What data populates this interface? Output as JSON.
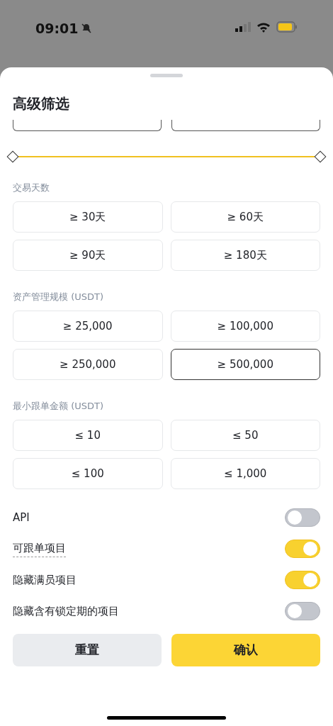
{
  "status_bar": {
    "time": "09:01",
    "silent": true
  },
  "sheet": {
    "title": "高级筛选",
    "range_fields": [
      {
        "kind": "field"
      },
      {
        "kind": "field"
      }
    ],
    "range_slider": {
      "thumbs": [
        {
          "level": 0
        },
        {
          "level": 1
        }
      ]
    },
    "sections": [
      {
        "label": "交易天数",
        "options": [
          {
            "label": "≥ 30天",
            "selected": false
          },
          {
            "label": "≥ 60天",
            "selected": false
          },
          {
            "label": "≥ 90天",
            "selected": false
          },
          {
            "label": "≥ 180天",
            "selected": false
          }
        ]
      },
      {
        "label": "资产管理规模 (USDT)",
        "options": [
          {
            "label": "≥ 25,000",
            "selected": false
          },
          {
            "label": "≥ 100,000",
            "selected": false
          },
          {
            "label": "≥ 250,000",
            "selected": false
          },
          {
            "label": "≥ 500,000",
            "selected": true
          }
        ]
      },
      {
        "label": "最小跟单金额 (USDT)",
        "options": [
          {
            "label": "≤ 10",
            "selected": false
          },
          {
            "label": "≤ 50",
            "selected": false
          },
          {
            "label": "≤ 100",
            "selected": false
          },
          {
            "label": "≤ 1,000",
            "selected": false
          }
        ]
      }
    ],
    "toggles": [
      {
        "label": "API",
        "on": false,
        "underlined": false
      },
      {
        "label": "可跟单项目",
        "on": true,
        "underlined": true
      },
      {
        "label": "隐藏满员项目",
        "on": true,
        "underlined": false
      },
      {
        "label": "隐藏含有锁定期的项目",
        "on": false,
        "underlined": false
      }
    ],
    "buttons": [
      {
        "label": "重置",
        "kind": "secondary"
      },
      {
        "label": "确认",
        "kind": "primary"
      }
    ]
  }
}
